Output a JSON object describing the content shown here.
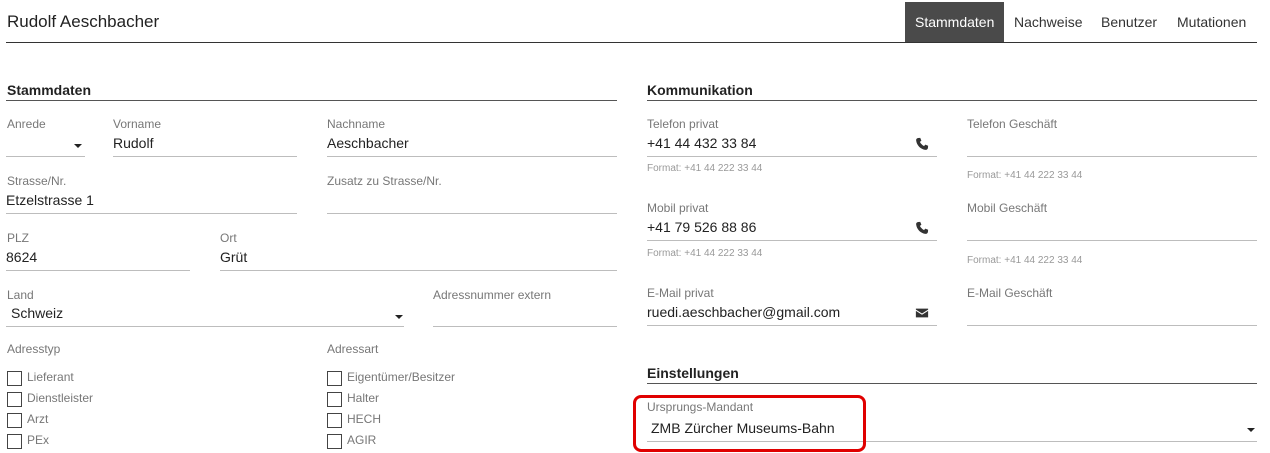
{
  "header": {
    "title": "Rudolf Aeschbacher",
    "tabs": [
      {
        "label": "Stammdaten",
        "active": true
      },
      {
        "label": "Nachweise",
        "active": false
      },
      {
        "label": "Benutzer",
        "active": false
      },
      {
        "label": "Mutationen",
        "active": false
      }
    ]
  },
  "stammdaten": {
    "title": "Stammdaten",
    "anrede": {
      "label": "Anrede",
      "value": ""
    },
    "vorname": {
      "label": "Vorname",
      "value": "Rudolf"
    },
    "nachname": {
      "label": "Nachname",
      "value": "Aeschbacher"
    },
    "strasse": {
      "label": "Strasse/Nr.",
      "value": "Etzelstrasse 1"
    },
    "zusatz": {
      "label": "Zusatz zu Strasse/Nr.",
      "value": ""
    },
    "plz": {
      "label": "PLZ",
      "value": "8624"
    },
    "ort": {
      "label": "Ort",
      "value": "Grüt"
    },
    "land": {
      "label": "Land",
      "value": "Schweiz"
    },
    "adressnummer": {
      "label": "Adressnummer extern",
      "value": ""
    },
    "adresstyp": {
      "label": "Adresstyp",
      "options": [
        "Lieferant",
        "Dienstleister",
        "Arzt",
        "PEx"
      ]
    },
    "adressart": {
      "label": "Adressart",
      "options": [
        "Eigentümer/Besitzer",
        "Halter",
        "HECH",
        "AGIR"
      ]
    }
  },
  "kommunikation": {
    "title": "Kommunikation",
    "format_hint": "Format: +41 44 222 33 44",
    "telefon_privat": {
      "label": "Telefon privat",
      "value": "+41 44 432 33 84"
    },
    "telefon_geschaeft": {
      "label": "Telefon Geschäft",
      "value": ""
    },
    "mobil_privat": {
      "label": "Mobil privat",
      "value": "+41 79 526 88 86"
    },
    "mobil_geschaeft": {
      "label": "Mobil Geschäft",
      "value": ""
    },
    "email_privat": {
      "label": "E-Mail privat",
      "value": "ruedi.aeschbacher@gmail.com"
    },
    "email_geschaeft": {
      "label": "E-Mail Geschäft",
      "value": ""
    }
  },
  "einstellungen": {
    "title": "Einstellungen",
    "mandant": {
      "label": "Ursprungs-Mandant",
      "value": "ZMB Zürcher Museums-Bahn"
    }
  },
  "icons": {
    "phone": "phone-icon",
    "mail": "envelope-icon",
    "dropdown": "caret-down-icon"
  },
  "colors": {
    "active_tab_bg": "#4a4a4a",
    "highlight": "#e00000"
  }
}
